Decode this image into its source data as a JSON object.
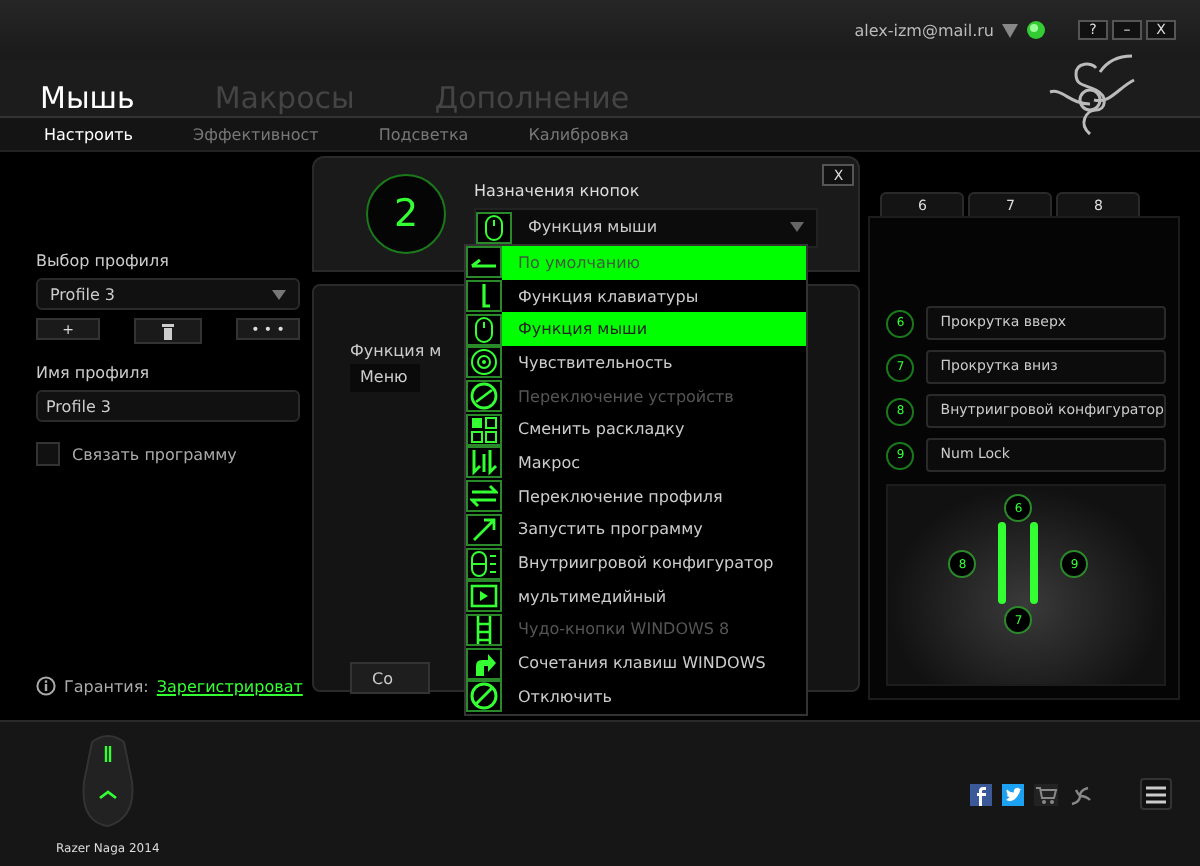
{
  "window": {
    "account": "alex-izm@mail.ru",
    "controls": [
      "?",
      "–",
      "X"
    ]
  },
  "main_tabs": [
    {
      "label": "Мышь",
      "selected": true
    },
    {
      "label": "Макросы",
      "selected": false
    },
    {
      "label": "Дополнение",
      "selected": false
    }
  ],
  "sub_tabs": [
    {
      "label": "Настроить",
      "selected": true
    },
    {
      "label": "Эффективност",
      "selected": false
    },
    {
      "label": "Подсветка",
      "selected": false
    },
    {
      "label": "Калибровка",
      "selected": false
    }
  ],
  "profile": {
    "select_label": "Выбор профиля",
    "selected_profile": "Profile 3",
    "add_button": "+",
    "more_button": "• • •",
    "name_label": "Имя профиля",
    "name_value": "Profile 3",
    "link_program": {
      "label": "Связать программу",
      "checked": false
    },
    "warranty_label": "Гарантия:",
    "warranty_link": "Зарегистрироват"
  },
  "button_assignment": {
    "button_number": "2",
    "label": "Назначения кнопок",
    "selected_function": "Функция мыши",
    "close": "X",
    "function_label": "Функция м",
    "function_value": "Меню",
    "save_button": "Со",
    "menu": [
      {
        "kind": "default",
        "label": "По умолчанию",
        "selected": false,
        "hovered": true,
        "disabled": false
      },
      {
        "kind": "keyboard",
        "label": "Функция клавиатуры",
        "selected": false,
        "hovered": false,
        "disabled": false
      },
      {
        "kind": "mouse",
        "label": "Функция мыши",
        "selected": true,
        "hovered": false,
        "disabled": false
      },
      {
        "kind": "sensitivity",
        "label": "Чувствительность",
        "selected": false,
        "hovered": false,
        "disabled": false
      },
      {
        "kind": "device",
        "label": "Переключение устройств",
        "selected": false,
        "hovered": false,
        "disabled": true
      },
      {
        "kind": "layout",
        "label": "Сменить раскладку",
        "selected": false,
        "hovered": false,
        "disabled": false
      },
      {
        "kind": "macro",
        "label": "Макрос",
        "selected": false,
        "hovered": false,
        "disabled": false
      },
      {
        "kind": "profile",
        "label": "Переключение профиля",
        "selected": false,
        "hovered": false,
        "disabled": false
      },
      {
        "kind": "program",
        "label": "Запустить программу",
        "selected": false,
        "hovered": false,
        "disabled": false
      },
      {
        "kind": "configurator",
        "label": "Внутриигровой конфигуратор",
        "selected": false,
        "hovered": false,
        "disabled": false
      },
      {
        "kind": "media",
        "label": "мультимедийный",
        "selected": false,
        "hovered": false,
        "disabled": false
      },
      {
        "kind": "charms",
        "label": "Чудо-кнопки WINDOWS 8",
        "selected": false,
        "hovered": false,
        "disabled": true
      },
      {
        "kind": "shortcut",
        "label": "Сочетания клавиш WINDOWS",
        "selected": false,
        "hovered": false,
        "disabled": false
      },
      {
        "kind": "disable",
        "label": "Отключить",
        "selected": false,
        "hovered": false,
        "disabled": false
      }
    ]
  },
  "key_panel": {
    "tabs": [
      {
        "label": "6",
        "selected": false
      },
      {
        "label": "7",
        "selected": false
      },
      {
        "label": "8",
        "selected": false
      }
    ],
    "keys": [
      {
        "number": "6",
        "function": "Прокрутка вверх"
      },
      {
        "number": "7",
        "function": "Прокрутка вниз"
      },
      {
        "number": "8",
        "function": "Внутриигровой конфигуратор"
      },
      {
        "number": "9",
        "function": "Num Lock"
      }
    ],
    "mouse_badges": [
      "6",
      "8",
      "9",
      "7"
    ]
  },
  "footer": {
    "device": "Razer Naga 2014"
  }
}
